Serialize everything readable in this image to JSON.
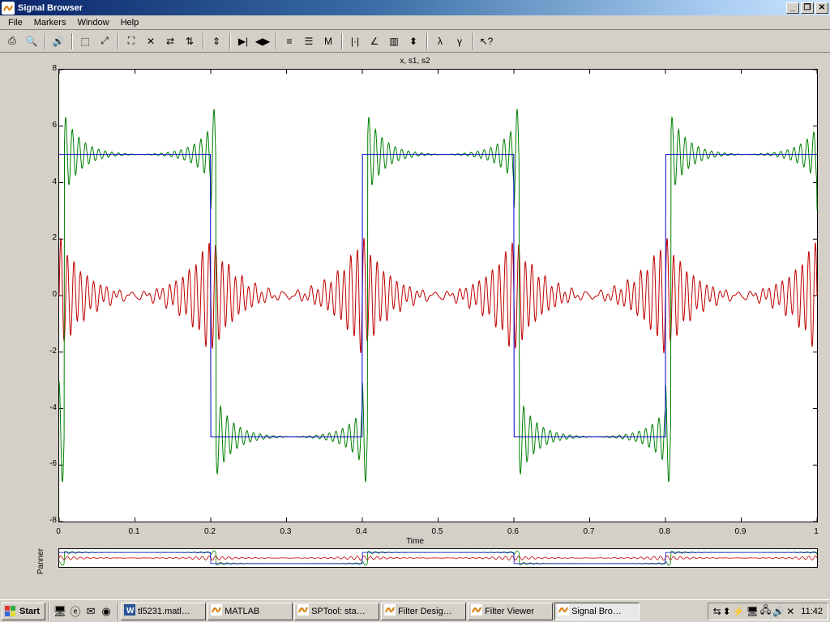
{
  "window": {
    "title": "Signal Browser"
  },
  "menu": {
    "items": [
      "File",
      "Markers",
      "Window",
      "Help"
    ]
  },
  "toolbar": {
    "buttons": [
      {
        "name": "print-icon",
        "glyph": "⎙"
      },
      {
        "name": "print-preview-icon",
        "glyph": "🔍"
      },
      {
        "name": "sep"
      },
      {
        "name": "play-sound-icon",
        "glyph": "🔊"
      },
      {
        "name": "sep"
      },
      {
        "name": "select-tool-icon",
        "glyph": "⬚"
      },
      {
        "name": "zoom-rect-icon",
        "glyph": "⤢"
      },
      {
        "name": "sep"
      },
      {
        "name": "zoom-full-icon",
        "glyph": "⛶"
      },
      {
        "name": "zoom-xy-icon",
        "glyph": "✕"
      },
      {
        "name": "zoom-x-icon",
        "glyph": "⇄"
      },
      {
        "name": "zoom-y-icon",
        "glyph": "⇅"
      },
      {
        "name": "sep"
      },
      {
        "name": "zoom-out-y-icon",
        "glyph": "⇕"
      },
      {
        "name": "sep"
      },
      {
        "name": "marker-next-icon",
        "glyph": "▶|"
      },
      {
        "name": "marker-prev-icon",
        "glyph": "◀▶"
      },
      {
        "name": "sep"
      },
      {
        "name": "line-props-icon",
        "glyph": "≡"
      },
      {
        "name": "color-props-icon",
        "glyph": "☰"
      },
      {
        "name": "marker-toggle-icon",
        "glyph": "M"
      },
      {
        "name": "sep"
      },
      {
        "name": "complex-real-icon",
        "glyph": "|·|"
      },
      {
        "name": "complex-imag-icon",
        "glyph": "∠"
      },
      {
        "name": "complex-mag-icon",
        "glyph": "▥"
      },
      {
        "name": "complex-angle-icon",
        "glyph": "⬍"
      },
      {
        "name": "sep"
      },
      {
        "name": "tool-a-icon",
        "glyph": "λ"
      },
      {
        "name": "tool-b-icon",
        "glyph": "γ"
      },
      {
        "name": "sep"
      },
      {
        "name": "whats-this-icon",
        "glyph": "↖?"
      }
    ]
  },
  "chart_data": {
    "type": "line",
    "title": "x, s1, s2",
    "xlabel": "Time",
    "ylabel": "",
    "xlim": [
      0,
      1
    ],
    "ylim": [
      -8,
      8
    ],
    "xticks": [
      0,
      0.1,
      0.2,
      0.3,
      0.4,
      0.5,
      0.6,
      0.7,
      0.8,
      0.9,
      1
    ],
    "yticks": [
      -8,
      -6,
      -4,
      -2,
      0,
      2,
      4,
      6,
      8
    ],
    "series": [
      {
        "name": "x",
        "color": "#0000cd",
        "description": "Square wave, amplitude 5, period 0.4, starting high at t=0",
        "period": 0.4,
        "amplitude": 5,
        "phase_high_start": 0
      },
      {
        "name": "s1",
        "color": "#008000",
        "description": "Low-pass filtered square wave with Gibbs ringing (overshoot ≈ 7, undershoot ≈ -7)",
        "base_period": 0.4,
        "base_amplitude": 5,
        "overshoot": 1.95,
        "ringing_freq_hz": 115,
        "ringing_decay": 45,
        "delay": 0.007
      },
      {
        "name": "s2",
        "color": "#c00000",
        "description": "High-pass residual / impulse response at each square edge, decaying sinusoid around 0",
        "peak_amplitude": 2.1,
        "ringing_freq_hz": 115,
        "ringing_decay": 30,
        "edge_times": [
          0,
          0.2,
          0.4,
          0.6,
          0.8,
          1.0
        ]
      }
    ]
  },
  "panner": {
    "label": "Panner"
  },
  "taskbar": {
    "start": "Start",
    "tasks": [
      {
        "label": "tl5231.matl…",
        "active": false,
        "icon": "word"
      },
      {
        "label": "MATLAB",
        "active": false,
        "icon": "matlab"
      },
      {
        "label": "SPTool: sta…",
        "active": false,
        "icon": "matlab"
      },
      {
        "label": "Filter Desig…",
        "active": false,
        "icon": "matlab"
      },
      {
        "label": "Filter Viewer",
        "active": false,
        "icon": "matlab"
      },
      {
        "label": "Signal Bro…",
        "active": true,
        "icon": "matlab"
      }
    ],
    "clock": "11:42"
  }
}
